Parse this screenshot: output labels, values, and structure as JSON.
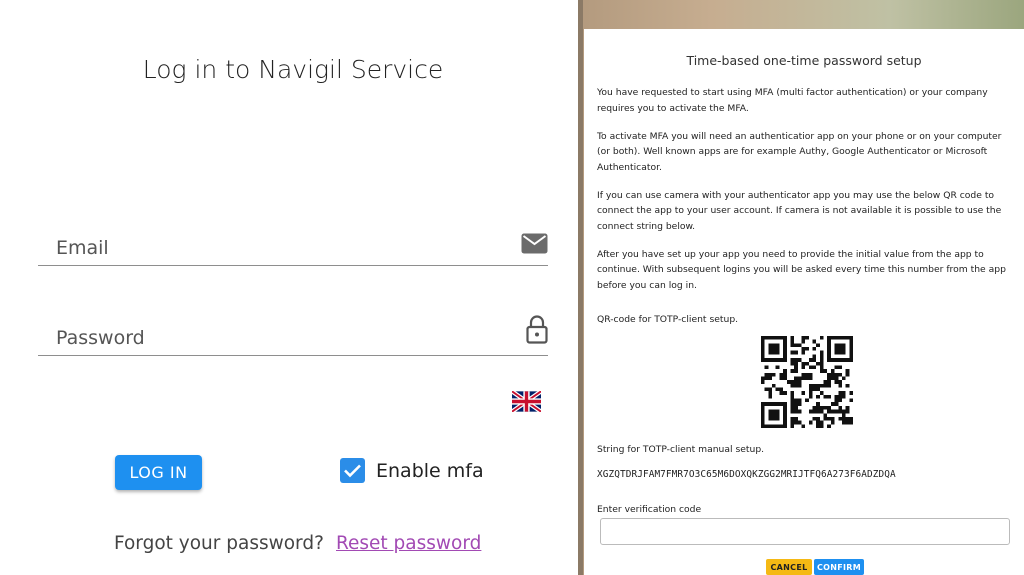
{
  "login": {
    "title": "Log in to Navigil Service",
    "email_label": "Email",
    "password_label": "Password",
    "login_button": "LOG IN",
    "mfa_label": "Enable mfa",
    "mfa_checked": true,
    "forgot_text": "Forgot your password?",
    "reset_link": "Reset password",
    "language_icon": "uk-flag-icon",
    "colors": {
      "accent": "#1e90f0",
      "link": "#a24ab4"
    }
  },
  "mfa_modal": {
    "title": "Time-based one-time password setup",
    "paragraphs": [
      "You have requested to start using MFA (multi factor authentication) or your company requires you to activate the MFA.",
      "To activate MFA you will need an authenticatior app on your phone or on your computer (or both). Well known apps are for example Authy, Google Authenticator or Microsoft Authenticator.",
      "If you can use camera with your authenticator app you may use the below QR code to connect the app to your user account. If camera is not available it is possible to use the connect string below.",
      "After you have set up your app you need to provide the initial value from the app to continue. With subsequent logins you will be asked every time this number from the app before you can log in."
    ],
    "qr_label": "QR-code for TOTP-client setup.",
    "manual_label": "String for TOTP-client manual setup.",
    "secret": "XGZQTDRJFAM7FMR7O3C65M6DOXQKZGG2MRIJTFQ6A273F6ADZDQA",
    "verify_label": "Enter verification code",
    "verify_value": "",
    "cancel_button": "CANCEL",
    "confirm_button": "CONFIRM",
    "colors": {
      "cancel": "#f5b914",
      "confirm": "#1e90f0"
    }
  }
}
